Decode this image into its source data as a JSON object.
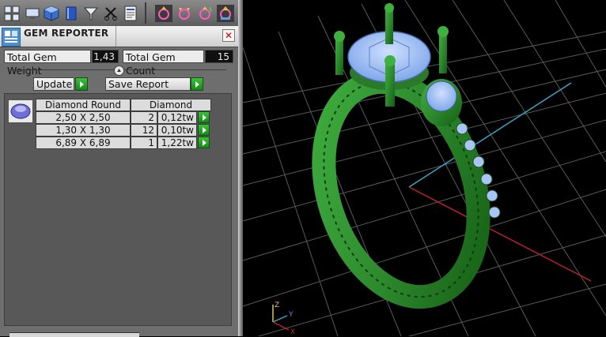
{
  "app": {
    "toolbar_icons": [
      "layout-icon",
      "monitor-icon",
      "cube-icon",
      "book-icon",
      "filter-icon",
      "scissors-icon",
      "report-sheet-icon",
      "ring-gizmo-icon",
      "ring-gizmo-icon",
      "ring-gizmo-icon",
      "ring-gizmo-icon"
    ]
  },
  "panel": {
    "title": "GEM REPORTER",
    "close_icon": "close-icon"
  },
  "stats": {
    "total_weight_label": "Total Gem Weight",
    "total_weight_value": "1,43",
    "total_count_label": "Total Gem Count",
    "total_count_value": "15"
  },
  "actions": {
    "update_label": "Update",
    "save_label": "Save Report"
  },
  "gem_table": {
    "headers": {
      "shape": "Diamond Round",
      "material": "Diamond"
    },
    "rows": [
      {
        "size": "2,50 X 2,50",
        "count": "2",
        "weight": "0,12tw"
      },
      {
        "size": "1,30 X 1,30",
        "count": "12",
        "weight": "0,10tw"
      },
      {
        "size": "6,89 X 6,89",
        "count": "1",
        "weight": "1,22tw"
      }
    ]
  },
  "viewport": {
    "axis_labels": {
      "z": "Z",
      "y": "Y",
      "x": "X"
    },
    "colors": {
      "metal": "#2e8b2e",
      "gem": "#8fb7f0",
      "grid": "#6a6a6a",
      "x_axis": "#c0202a",
      "y_axis": "#3aa5c8"
    }
  }
}
